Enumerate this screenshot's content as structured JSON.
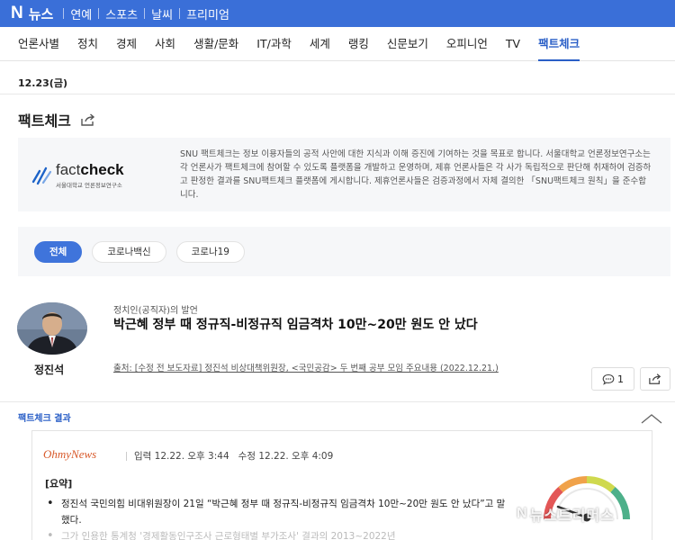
{
  "top_bar": {
    "brand_mark": "N",
    "brand_label": "뉴스",
    "nav": [
      "연예",
      "스포츠",
      "날씨",
      "프리미엄"
    ]
  },
  "main_nav": {
    "items": [
      "언론사별",
      "정치",
      "경제",
      "사회",
      "생활/문화",
      "IT/과학",
      "세계",
      "랭킹",
      "신문보기",
      "오피니언",
      "TV",
      "팩트체크"
    ],
    "active": "팩트체크"
  },
  "date": "12.23(금)",
  "page_title": "팩트체크",
  "info_box": {
    "logo_word_light": "fact",
    "logo_word_bold": "check",
    "logo_sub": "서울대학교 언론정보연구소",
    "text": "SNU 팩트체크는 정보 이용자들의 공적 사안에 대한 지식과 이해 증진에 기여하는 것을 목표로 합니다. 서울대학교 언론정보연구소는 각 언론사가 팩트체크에 참여할 수 있도록 플랫폼을 개발하고 운영하며, 제휴 언론사들은 각 사가 독립적으로 판단해 취재하여 검증하고 판정한 결과를 SNU팩트체크 플랫폼에 게시합니다. 제휴언론사들은 검증과정에서 자체 결의한 「SNU팩트체크 원칙」을 준수합니다."
  },
  "filters": {
    "items": [
      "전체",
      "코로나백신",
      "코로나19"
    ],
    "active": "전체"
  },
  "article": {
    "person_name": "정진석",
    "category": "정치인(공직자)의 발언",
    "headline": "박근혜 정부 때 정규직-비정규직 임금격차 10만~20만 원도 안 났다",
    "source": "출처: [수정 전 보도자료] 정진석 비상대책위원장, <국민공감> 두 번째 공부 모임 주요내용 (2022.12.21.)",
    "comment_count": "1"
  },
  "result": {
    "section_label": "팩트체크 결과",
    "press_name": "OhmyNews",
    "input_time": "입력 12.22. 오후 3:44",
    "edit_time": "수정 12.22. 오후 4:09",
    "summary_title": "[요약]",
    "bullets": [
      "정진석 국민의힘 비대위원장이 21일 “박근혜 정부 때 정규직-비정규직 임금격차 10만~20만 원도 안 났다”고 말했다.",
      "그가 인용한 통계청 '경제활동인구조사 근로형태별 부가조사' 결과의 2013~2022년"
    ]
  },
  "watermark": {
    "mark": "N",
    "text": "뉴스트리머스"
  },
  "colors": {
    "brand_blue": "#3a6fd8",
    "active_nav": "#2a5fc7",
    "press_orange": "#d85a2b"
  }
}
